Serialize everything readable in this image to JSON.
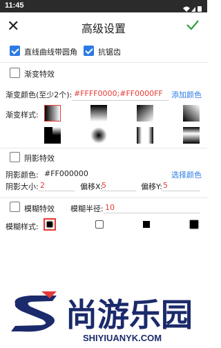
{
  "status_bar": {
    "time": "11:45"
  },
  "header": {
    "title": "高级设置"
  },
  "options": {
    "round_corners": "直线曲线带圆角",
    "antialias": "抗锯齿"
  },
  "gradient": {
    "label": "渐变特效",
    "color_label": "渐变颜色(至少2个):",
    "color_value": "#FFFF0000;#FF0000FF",
    "add_color": "添加颜色",
    "style_label": "渐变样式:"
  },
  "shadow": {
    "label": "阴影特效",
    "color_label": "阴影颜色:",
    "color_value": "#FF000000",
    "choose_color": "选择颜色",
    "size_label": "阴影大小:",
    "size_value": "2",
    "offset_x_label": "偏移X:",
    "offset_x_value": "5",
    "offset_y_label": "偏移Y:",
    "offset_y_value": "5"
  },
  "blur": {
    "label": "模糊特效",
    "radius_label": "模糊半径:",
    "radius_value": "10",
    "style_label": "模糊样式:"
  },
  "watermark": {
    "name": "尚游乐园",
    "url": "SHIYIUANYK.COM"
  },
  "colors": {
    "accent": "#2c7be5",
    "red": "#e53935",
    "check_green": "#2e9d3a"
  }
}
